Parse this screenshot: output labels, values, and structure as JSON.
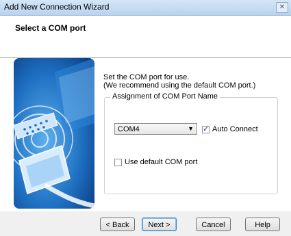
{
  "window": {
    "title": "Add New Connection Wizard",
    "close_glyph": "✕"
  },
  "header": {
    "title": "Select a COM port"
  },
  "description": {
    "line1": "Set the COM port for use.",
    "line2": "(We recommend using the default COM port.)"
  },
  "group": {
    "title": "Assignment of COM Port Name",
    "com_port": {
      "selected": "COM4"
    },
    "auto_connect": {
      "label": "Auto Connect",
      "checked": true
    },
    "use_default": {
      "label": "Use default COM port",
      "checked": false
    }
  },
  "buttons": {
    "back": "< Back",
    "next": "Next >",
    "cancel": "Cancel",
    "help": "Help"
  },
  "icons": [
    "close-icon",
    "chevron-down-icon",
    "checkmark-icon",
    "wizard-illustration"
  ],
  "colors": {
    "image_bg": "#1e6fc1",
    "default_button_border": "#3c7fb1"
  }
}
